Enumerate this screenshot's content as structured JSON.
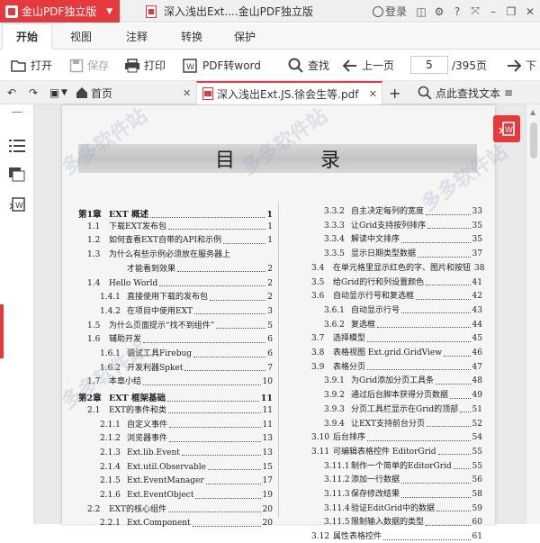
{
  "titlebar": {
    "app_name": "金山PDF独立版",
    "doc_title": "深入浅出Ext....金山PDF独立版",
    "login_label": "登录"
  },
  "ribbon_tabs": [
    "开始",
    "视图",
    "注释",
    "转换",
    "保护"
  ],
  "toolbar": {
    "open": "打开",
    "save": "保存",
    "print": "打印",
    "pdf_to_word": "PDF转word",
    "find": "查找",
    "prev_page": "上一页",
    "page_current": "5",
    "page_total": "/395页",
    "next_page": "下"
  },
  "doc_tabs": {
    "home": "首页",
    "document": "深入浅出Ext.JS.徐会生等.pdf",
    "search_text": "点此查找文本"
  },
  "page": {
    "heading": "目 录",
    "left": [
      {
        "n": "第1章",
        "t": "EXT 概述",
        "p": "1",
        "chap": true
      },
      {
        "n": "1.1",
        "t": "下载EXT发布包",
        "p": "1"
      },
      {
        "n": "1.2",
        "t": "如何查看EXT自带的API和示例",
        "p": "1"
      },
      {
        "n": "1.3",
        "t": "为什么有些示例必须放在服务器上",
        "p": ""
      },
      {
        "n": "",
        "t": "才能看到效果",
        "p": "2"
      },
      {
        "n": "1.4",
        "t": "Hello World",
        "p": "2"
      },
      {
        "n": "1.4.1",
        "t": "直接使用下载的发布包",
        "p": "2"
      },
      {
        "n": "1.4.2",
        "t": "在项目中使用EXT",
        "p": "3"
      },
      {
        "n": "1.5",
        "t": "为什么页面提示“找不到组件”",
        "p": "5"
      },
      {
        "n": "1.6",
        "t": "辅助开发",
        "p": "6"
      },
      {
        "n": "1.6.1",
        "t": "调试工具Firebug",
        "p": "6"
      },
      {
        "n": "1.6.2",
        "t": "开发利器Spket",
        "p": "7"
      },
      {
        "n": "1.7",
        "t": "本章小结",
        "p": "10"
      },
      {
        "n": "第2章",
        "t": "EXT 框架基础",
        "p": "11",
        "chap": true
      },
      {
        "n": "2.1",
        "t": "EXT的事件和类",
        "p": "11"
      },
      {
        "n": "2.1.1",
        "t": "自定义事件",
        "p": "11"
      },
      {
        "n": "2.1.2",
        "t": "浏览器事件",
        "p": "13"
      },
      {
        "n": "2.1.3",
        "t": "Ext.lib.Event",
        "p": "13"
      },
      {
        "n": "2.1.4",
        "t": "Ext.util.Observable",
        "p": "15"
      },
      {
        "n": "2.1.5",
        "t": "Ext.EventManager",
        "p": "17"
      },
      {
        "n": "2.1.6",
        "t": "Ext.EventObject",
        "p": "19"
      },
      {
        "n": "2.2",
        "t": "EXT的核心组件",
        "p": "20"
      },
      {
        "n": "2.2.1",
        "t": "Ext.Component",
        "p": "20"
      }
    ],
    "right": [
      {
        "n": "3.3.2",
        "t": "自主决定每列的宽度",
        "p": "33"
      },
      {
        "n": "3.3.3",
        "t": "让Grid支持按列排序",
        "p": "35"
      },
      {
        "n": "3.3.4",
        "t": "解读中文排序",
        "p": "35"
      },
      {
        "n": "3.3.5",
        "t": "显示日期类型数据",
        "p": "37"
      },
      {
        "n": "3.4",
        "t": "在单元格里显示红色的字、图片和按钮",
        "p": "38"
      },
      {
        "n": "3.5",
        "t": "给Grid的行和列设置颜色",
        "p": "41"
      },
      {
        "n": "3.6",
        "t": "自动显示行号和复选框",
        "p": "42"
      },
      {
        "n": "3.6.1",
        "t": "自动显示行号",
        "p": "43"
      },
      {
        "n": "3.6.2",
        "t": "复选框",
        "p": "44"
      },
      {
        "n": "3.7",
        "t": "选择模型",
        "p": "45"
      },
      {
        "n": "3.8",
        "t": "表格视图  Ext.grid.GridView",
        "p": "46"
      },
      {
        "n": "3.9",
        "t": "表格分页",
        "p": "47"
      },
      {
        "n": "3.9.1",
        "t": "为Grid添加分页工具条",
        "p": "48"
      },
      {
        "n": "3.9.2",
        "t": "通过后台脚本获得分页数据",
        "p": "49"
      },
      {
        "n": "3.9.3",
        "t": "分页工具栏显示在Grid的顶部",
        "p": "51"
      },
      {
        "n": "3.9.4",
        "t": "让EXT支持前台分页",
        "p": "52"
      },
      {
        "n": "3.10",
        "t": "后台排序",
        "p": "54"
      },
      {
        "n": "3.11",
        "t": "可编辑表格控件  EditorGrid",
        "p": "55"
      },
      {
        "n": "3.11.1",
        "t": "制作一个简单的EditorGrid",
        "p": "55"
      },
      {
        "n": "3.11.2",
        "t": "添加一行数据",
        "p": "56"
      },
      {
        "n": "3.11.3",
        "t": "保存修改结果",
        "p": "58"
      },
      {
        "n": "3.11.4",
        "t": "验证EditGrid中的数据",
        "p": "59"
      },
      {
        "n": "3.11.5",
        "t": "限制输入数据的类型",
        "p": "60"
      },
      {
        "n": "3.12",
        "t": "属性表格控件",
        "p": "61"
      }
    ]
  },
  "watermark_text": "多多软件站",
  "colors": {
    "accent": "#e5393c"
  }
}
